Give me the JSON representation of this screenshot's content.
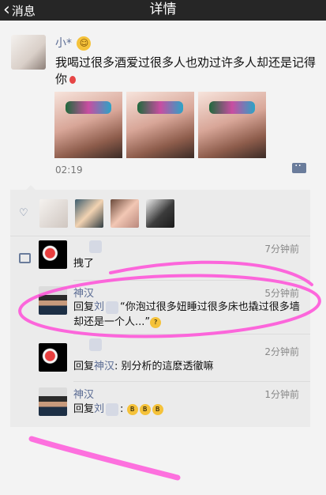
{
  "nav": {
    "back_label": "消息",
    "title": "详情"
  },
  "post": {
    "author": "小*",
    "author_emoji": "smile-emoji",
    "text": "我喝过很多酒爱过很多人也劝过许多人却还是记得你",
    "time": "02:19",
    "photos": [
      "photo-1",
      "photo-2",
      "photo-3"
    ]
  },
  "likes": {
    "icon": "heart-icon",
    "count": 4
  },
  "comments": [
    {
      "name": "",
      "time": "7分钟前",
      "text": "拽了"
    },
    {
      "name": "神汉",
      "time": "5分钟前",
      "prefix": "回复",
      "target": "刘",
      "text": "“你泡过很多妞睡过很多床也撬过很多墙却还是一个人...”"
    },
    {
      "name": "",
      "time": "2分钟前",
      "prefix": "回复",
      "target": "神汉",
      "text": ": 别分析的這麽透徹嘛"
    },
    {
      "name": "神汉",
      "time": "1分钟前",
      "prefix": "回复",
      "target": "刘",
      "text": ":"
    }
  ],
  "colors": {
    "nav_bg": "#262626",
    "link": "#5a6b93",
    "panel_bg": "#ebebeb",
    "highlight": "#ff4fd8"
  }
}
